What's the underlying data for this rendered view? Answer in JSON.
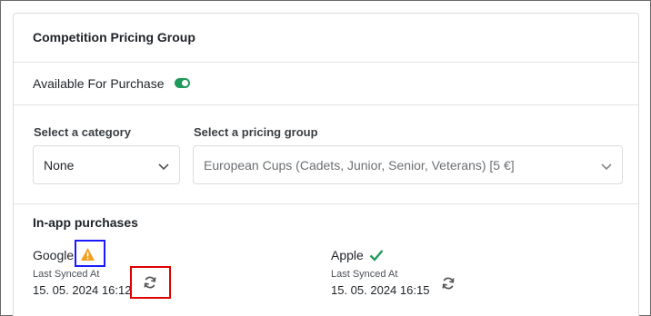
{
  "card": {
    "title": "Competition Pricing Group",
    "availability": {
      "label": "Available For Purchase",
      "enabled": true
    },
    "category": {
      "label": "Select a category",
      "value": "None"
    },
    "pricing_group": {
      "label": "Select a pricing group",
      "value": "European Cups (Cadets, Junior, Senior, Veterans) [5 €]"
    },
    "in_app": {
      "title": "In-app purchases",
      "google": {
        "name": "Google",
        "status_icon": "warning-icon",
        "synced_label": "Last Synced At",
        "synced_value": "15. 05. 2024 16:12"
      },
      "apple": {
        "name": "Apple",
        "status_icon": "check-icon",
        "synced_label": "Last Synced At",
        "synced_value": "15. 05. 2024 16:15"
      }
    }
  },
  "colors": {
    "accent_green": "#1e9a5a",
    "warning_orange": "#f0a020",
    "highlight_blue": "#1a1aff",
    "highlight_red": "#e00000"
  }
}
